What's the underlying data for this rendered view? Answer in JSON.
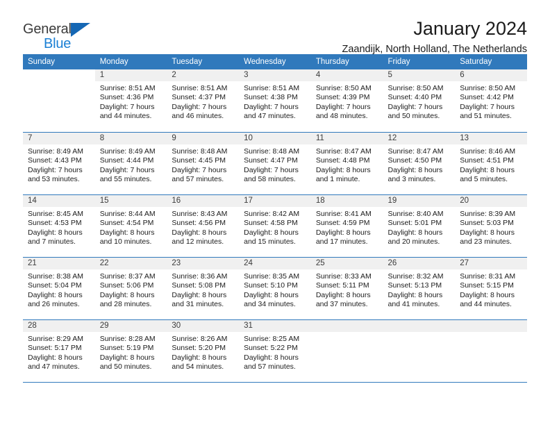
{
  "brand": {
    "name_part1": "General",
    "name_part2": "Blue",
    "triangle_color": "#1567b4",
    "blue_color": "#1a7fd4"
  },
  "header": {
    "title": "January 2024",
    "subtitle": "Zaandijk, North Holland, The Netherlands"
  },
  "theme": {
    "header_blue": "#3079bc",
    "daynum_band_gray": "#f0f0f0",
    "text_color": "#1b1b1b"
  },
  "weekdays": [
    "Sunday",
    "Monday",
    "Tuesday",
    "Wednesday",
    "Thursday",
    "Friday",
    "Saturday"
  ],
  "weeks": [
    [
      {
        "day": "",
        "sunrise": "",
        "sunset": "",
        "daylight_line1": "",
        "daylight_line2": "",
        "band": "empty"
      },
      {
        "day": "1",
        "sunrise": "Sunrise: 8:51 AM",
        "sunset": "Sunset: 4:36 PM",
        "daylight_line1": "Daylight: 7 hours",
        "daylight_line2": "and 44 minutes.",
        "band": "filled"
      },
      {
        "day": "2",
        "sunrise": "Sunrise: 8:51 AM",
        "sunset": "Sunset: 4:37 PM",
        "daylight_line1": "Daylight: 7 hours",
        "daylight_line2": "and 46 minutes.",
        "band": "filled"
      },
      {
        "day": "3",
        "sunrise": "Sunrise: 8:51 AM",
        "sunset": "Sunset: 4:38 PM",
        "daylight_line1": "Daylight: 7 hours",
        "daylight_line2": "and 47 minutes.",
        "band": "filled"
      },
      {
        "day": "4",
        "sunrise": "Sunrise: 8:50 AM",
        "sunset": "Sunset: 4:39 PM",
        "daylight_line1": "Daylight: 7 hours",
        "daylight_line2": "and 48 minutes.",
        "band": "filled"
      },
      {
        "day": "5",
        "sunrise": "Sunrise: 8:50 AM",
        "sunset": "Sunset: 4:40 PM",
        "daylight_line1": "Daylight: 7 hours",
        "daylight_line2": "and 50 minutes.",
        "band": "filled"
      },
      {
        "day": "6",
        "sunrise": "Sunrise: 8:50 AM",
        "sunset": "Sunset: 4:42 PM",
        "daylight_line1": "Daylight: 7 hours",
        "daylight_line2": "and 51 minutes.",
        "band": "filled"
      }
    ],
    [
      {
        "day": "7",
        "sunrise": "Sunrise: 8:49 AM",
        "sunset": "Sunset: 4:43 PM",
        "daylight_line1": "Daylight: 7 hours",
        "daylight_line2": "and 53 minutes.",
        "band": "filled"
      },
      {
        "day": "8",
        "sunrise": "Sunrise: 8:49 AM",
        "sunset": "Sunset: 4:44 PM",
        "daylight_line1": "Daylight: 7 hours",
        "daylight_line2": "and 55 minutes.",
        "band": "filled"
      },
      {
        "day": "9",
        "sunrise": "Sunrise: 8:48 AM",
        "sunset": "Sunset: 4:45 PM",
        "daylight_line1": "Daylight: 7 hours",
        "daylight_line2": "and 57 minutes.",
        "band": "filled"
      },
      {
        "day": "10",
        "sunrise": "Sunrise: 8:48 AM",
        "sunset": "Sunset: 4:47 PM",
        "daylight_line1": "Daylight: 7 hours",
        "daylight_line2": "and 58 minutes.",
        "band": "filled"
      },
      {
        "day": "11",
        "sunrise": "Sunrise: 8:47 AM",
        "sunset": "Sunset: 4:48 PM",
        "daylight_line1": "Daylight: 8 hours",
        "daylight_line2": "and 1 minute.",
        "band": "filled"
      },
      {
        "day": "12",
        "sunrise": "Sunrise: 8:47 AM",
        "sunset": "Sunset: 4:50 PM",
        "daylight_line1": "Daylight: 8 hours",
        "daylight_line2": "and 3 minutes.",
        "band": "filled"
      },
      {
        "day": "13",
        "sunrise": "Sunrise: 8:46 AM",
        "sunset": "Sunset: 4:51 PM",
        "daylight_line1": "Daylight: 8 hours",
        "daylight_line2": "and 5 minutes.",
        "band": "filled"
      }
    ],
    [
      {
        "day": "14",
        "sunrise": "Sunrise: 8:45 AM",
        "sunset": "Sunset: 4:53 PM",
        "daylight_line1": "Daylight: 8 hours",
        "daylight_line2": "and 7 minutes.",
        "band": "filled"
      },
      {
        "day": "15",
        "sunrise": "Sunrise: 8:44 AM",
        "sunset": "Sunset: 4:54 PM",
        "daylight_line1": "Daylight: 8 hours",
        "daylight_line2": "and 10 minutes.",
        "band": "filled"
      },
      {
        "day": "16",
        "sunrise": "Sunrise: 8:43 AM",
        "sunset": "Sunset: 4:56 PM",
        "daylight_line1": "Daylight: 8 hours",
        "daylight_line2": "and 12 minutes.",
        "band": "filled"
      },
      {
        "day": "17",
        "sunrise": "Sunrise: 8:42 AM",
        "sunset": "Sunset: 4:58 PM",
        "daylight_line1": "Daylight: 8 hours",
        "daylight_line2": "and 15 minutes.",
        "band": "filled"
      },
      {
        "day": "18",
        "sunrise": "Sunrise: 8:41 AM",
        "sunset": "Sunset: 4:59 PM",
        "daylight_line1": "Daylight: 8 hours",
        "daylight_line2": "and 17 minutes.",
        "band": "filled"
      },
      {
        "day": "19",
        "sunrise": "Sunrise: 8:40 AM",
        "sunset": "Sunset: 5:01 PM",
        "daylight_line1": "Daylight: 8 hours",
        "daylight_line2": "and 20 minutes.",
        "band": "filled"
      },
      {
        "day": "20",
        "sunrise": "Sunrise: 8:39 AM",
        "sunset": "Sunset: 5:03 PM",
        "daylight_line1": "Daylight: 8 hours",
        "daylight_line2": "and 23 minutes.",
        "band": "filled"
      }
    ],
    [
      {
        "day": "21",
        "sunrise": "Sunrise: 8:38 AM",
        "sunset": "Sunset: 5:04 PM",
        "daylight_line1": "Daylight: 8 hours",
        "daylight_line2": "and 26 minutes.",
        "band": "filled"
      },
      {
        "day": "22",
        "sunrise": "Sunrise: 8:37 AM",
        "sunset": "Sunset: 5:06 PM",
        "daylight_line1": "Daylight: 8 hours",
        "daylight_line2": "and 28 minutes.",
        "band": "filled"
      },
      {
        "day": "23",
        "sunrise": "Sunrise: 8:36 AM",
        "sunset": "Sunset: 5:08 PM",
        "daylight_line1": "Daylight: 8 hours",
        "daylight_line2": "and 31 minutes.",
        "band": "filled"
      },
      {
        "day": "24",
        "sunrise": "Sunrise: 8:35 AM",
        "sunset": "Sunset: 5:10 PM",
        "daylight_line1": "Daylight: 8 hours",
        "daylight_line2": "and 34 minutes.",
        "band": "filled"
      },
      {
        "day": "25",
        "sunrise": "Sunrise: 8:33 AM",
        "sunset": "Sunset: 5:11 PM",
        "daylight_line1": "Daylight: 8 hours",
        "daylight_line2": "and 37 minutes.",
        "band": "filled"
      },
      {
        "day": "26",
        "sunrise": "Sunrise: 8:32 AM",
        "sunset": "Sunset: 5:13 PM",
        "daylight_line1": "Daylight: 8 hours",
        "daylight_line2": "and 41 minutes.",
        "band": "filled"
      },
      {
        "day": "27",
        "sunrise": "Sunrise: 8:31 AM",
        "sunset": "Sunset: 5:15 PM",
        "daylight_line1": "Daylight: 8 hours",
        "daylight_line2": "and 44 minutes.",
        "band": "filled"
      }
    ],
    [
      {
        "day": "28",
        "sunrise": "Sunrise: 8:29 AM",
        "sunset": "Sunset: 5:17 PM",
        "daylight_line1": "Daylight: 8 hours",
        "daylight_line2": "and 47 minutes.",
        "band": "filled"
      },
      {
        "day": "29",
        "sunrise": "Sunrise: 8:28 AM",
        "sunset": "Sunset: 5:19 PM",
        "daylight_line1": "Daylight: 8 hours",
        "daylight_line2": "and 50 minutes.",
        "band": "filled"
      },
      {
        "day": "30",
        "sunrise": "Sunrise: 8:26 AM",
        "sunset": "Sunset: 5:20 PM",
        "daylight_line1": "Daylight: 8 hours",
        "daylight_line2": "and 54 minutes.",
        "band": "filled"
      },
      {
        "day": "31",
        "sunrise": "Sunrise: 8:25 AM",
        "sunset": "Sunset: 5:22 PM",
        "daylight_line1": "Daylight: 8 hours",
        "daylight_line2": "and 57 minutes.",
        "band": "filled"
      },
      {
        "day": "",
        "sunrise": "",
        "sunset": "",
        "daylight_line1": "",
        "daylight_line2": "",
        "band": "blank-filled"
      },
      {
        "day": "",
        "sunrise": "",
        "sunset": "",
        "daylight_line1": "",
        "daylight_line2": "",
        "band": "blank-filled"
      },
      {
        "day": "",
        "sunrise": "",
        "sunset": "",
        "daylight_line1": "",
        "daylight_line2": "",
        "band": "blank-filled"
      }
    ]
  ]
}
